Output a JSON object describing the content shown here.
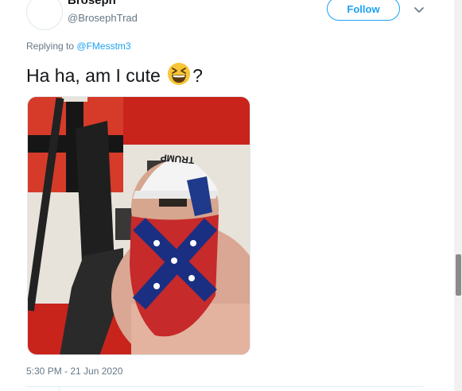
{
  "tweet": {
    "display_name": "Broseph",
    "handle": "@BrosephTrad",
    "follow_label": "Follow",
    "replying_prefix": "Replying to",
    "replying_to": "@FMesstm3",
    "text_before": "Ha ha, am I cute",
    "text_after": "?",
    "emoji_icon": "grinning-squinting-face-icon",
    "timestamp": "5:30 PM - 21 Jun 2020",
    "hat_text": "TRUMP",
    "photo_icon": "attached-photo"
  },
  "colors": {
    "accent": "#1da1f2",
    "secondary_text": "#657786",
    "divider": "#e6ecf0"
  }
}
